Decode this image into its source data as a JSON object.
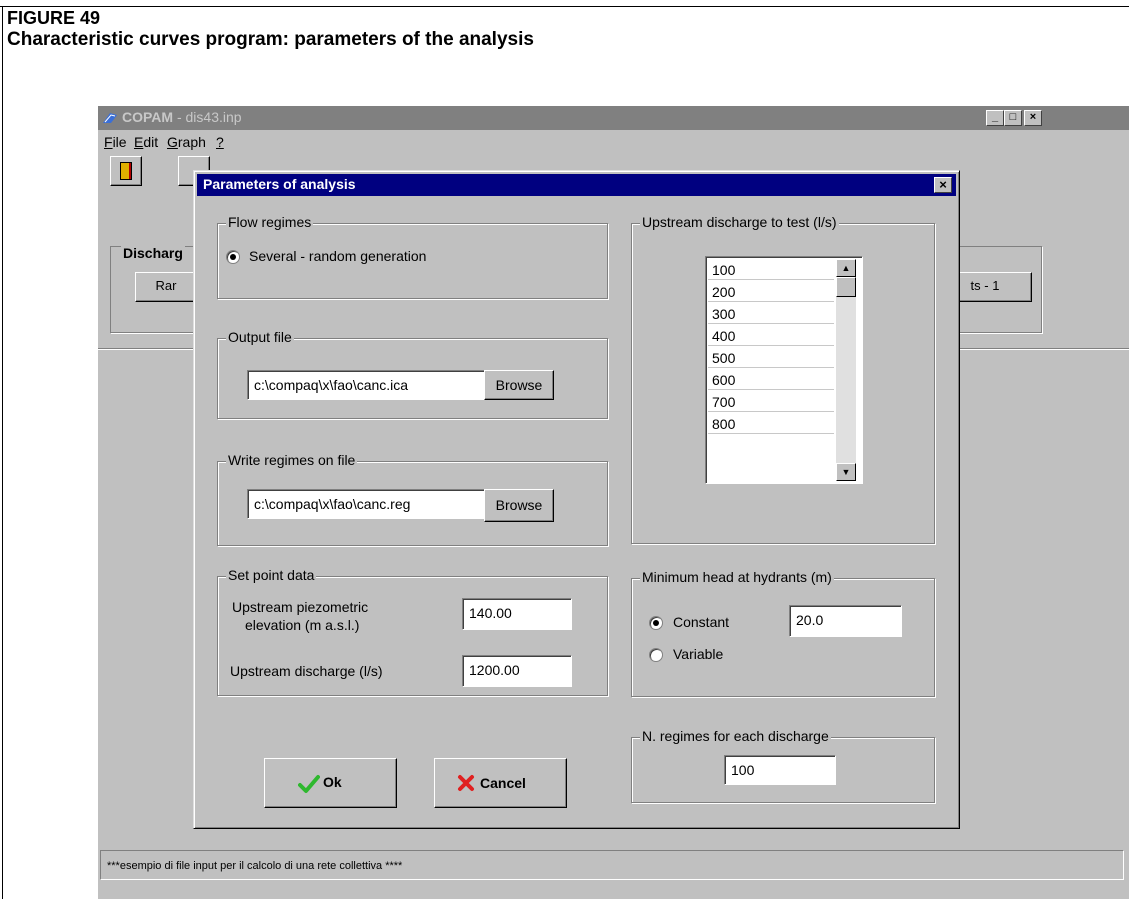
{
  "figure": {
    "number": "FIGURE 49",
    "caption": "Characteristic curves program: parameters of the analysis"
  },
  "window": {
    "title_app": "COPAM",
    "title_file": " - dis43.inp",
    "menu": [
      "File",
      "Edit",
      "Graph",
      "?"
    ],
    "group_label": "Discharg",
    "left_button": "Rar",
    "right_button": "ts - 1",
    "status": "***esempio di file input per il calcolo di una rete collettiva ****"
  },
  "dialog": {
    "title": "Parameters of analysis",
    "flow_regimes": {
      "label": "Flow regimes",
      "option": "Several - random generation",
      "selected": true
    },
    "output_file": {
      "label": "Output file",
      "path": "c:\\compaq\\x\\fao\\canc.ica",
      "browse": "Browse"
    },
    "write_regimes": {
      "label": "Write regimes on file",
      "path": "c:\\compaq\\x\\fao\\canc.reg",
      "browse": "Browse"
    },
    "set_point": {
      "label": "Set point data",
      "piezo_label_1": "Upstream piezometric",
      "piezo_label_2": "elevation (m a.s.l.)",
      "piezo_value": "140.00",
      "discharge_label": "Upstream discharge (l/s)",
      "discharge_value": "1200.00"
    },
    "upstream_discharge": {
      "label": "Upstream discharge to test (l/s)",
      "items": [
        "100",
        "200",
        "300",
        "400",
        "500",
        "600",
        "700",
        "800"
      ]
    },
    "min_head": {
      "label": "Minimum head at hydrants (m)",
      "constant": "Constant",
      "constant_value": "20.0",
      "variable": "Variable",
      "selected": "Constant"
    },
    "n_regimes": {
      "label": "N. regimes for each discharge",
      "value": "100"
    },
    "ok": "Ok",
    "cancel": "Cancel"
  },
  "colors": {
    "dialog_title_bg": "#000080",
    "window_bg": "#c0c0c0",
    "ok_check": "#2eb82e",
    "cancel_x": "#e02020"
  }
}
